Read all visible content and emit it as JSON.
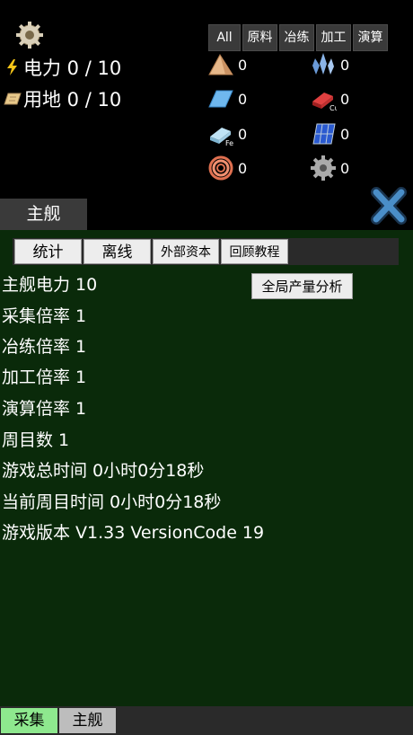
{
  "top": {
    "power": {
      "label": "电力 0 / 10",
      "icon": "lightning-icon"
    },
    "land": {
      "label": "用地 0 / 10",
      "icon": "map-icon"
    },
    "settings_icon": "gear-icon"
  },
  "filters": [
    "All",
    "原料",
    "冶练",
    "加工",
    "演算"
  ],
  "resources": [
    {
      "icon": "ore-pile-icon",
      "count": "0"
    },
    {
      "icon": "crystal-icon",
      "count": "0"
    },
    {
      "icon": "glass-plate-icon",
      "count": "0"
    },
    {
      "icon": "copper-ingot-icon",
      "count": "0"
    },
    {
      "icon": "iron-ingot-icon",
      "count": "0"
    },
    {
      "icon": "solar-panel-icon",
      "count": "0"
    },
    {
      "icon": "copper-coil-icon",
      "count": "0"
    },
    {
      "icon": "gear-part-icon",
      "count": "0"
    }
  ],
  "header": {
    "tab_label": "主舰",
    "close_icon": "close-icon"
  },
  "buttons": {
    "stats": "统计",
    "offline": "离线",
    "external_capital": "外部资本",
    "tutorial": "回顾教程",
    "analysis": "全局产量分析"
  },
  "info": {
    "power": "主舰电力 10",
    "collect_rate": "采集倍率 1",
    "smelt_rate": "冶练倍率 1",
    "process_rate": "加工倍率 1",
    "compute_rate": "演算倍率 1",
    "cycles": "周目数 1",
    "total_time": "游戏总时间 0小时0分18秒",
    "current_time": "当前周目时间 0小时0分18秒",
    "version": "游戏版本 V1.33 VersionCode 19"
  },
  "bottom_tabs": {
    "collect": "采集",
    "ship": "主舰"
  }
}
